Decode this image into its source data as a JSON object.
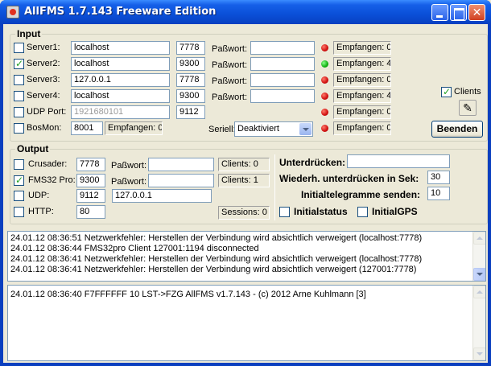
{
  "window": {
    "title": "AllFMS 1.7.143 Freeware Edition"
  },
  "input": {
    "title": "Input",
    "password_label": "Paßwort:",
    "rows": [
      {
        "label": "Server1:",
        "checked": false,
        "host": "localhost",
        "port": "7778",
        "password": "",
        "status": "red",
        "received": "Empfangen: 0"
      },
      {
        "label": "Server2:",
        "checked": true,
        "host": "localhost",
        "port": "9300",
        "password": "",
        "status": "green",
        "received": "Empfangen: 4"
      },
      {
        "label": "Server3:",
        "checked": false,
        "host": "127.0.0.1",
        "port": "7778",
        "password": "",
        "status": "red",
        "received": "Empfangen: 0"
      },
      {
        "label": "Server4:",
        "checked": false,
        "host": "localhost",
        "port": "9300",
        "password": "",
        "status": "red",
        "received": "Empfangen: 4"
      }
    ],
    "udp": {
      "label": "UDP Port:",
      "checked": false,
      "host": "1921680101",
      "port": "9112",
      "status": "red",
      "received": "Empfangen: 0"
    },
    "bosmon": {
      "label": "BosMon:",
      "checked": false,
      "port": "8001",
      "received": "Empfangen: 0"
    },
    "seriell": {
      "label": "Seriell:",
      "value": "Deaktiviert",
      "status": "red",
      "received": "Empfangen: 0"
    },
    "clients": {
      "label": "Clients",
      "checked": true,
      "icon": "monitor-icon"
    },
    "quit_button": "Beenden"
  },
  "output": {
    "title": "Output",
    "password_label": "Paßwort:",
    "crusader": {
      "label": "Crusader:",
      "checked": false,
      "port": "7778",
      "password": "",
      "status": "Clients: 0"
    },
    "fms32pro": {
      "label": "FMS32 Pro:",
      "checked": true,
      "port": "9300",
      "password": "",
      "status": "Clients: 1"
    },
    "udp": {
      "label": "UDP:",
      "checked": false,
      "port": "9112",
      "host": "127.0.0.1"
    },
    "http": {
      "label": "HTTP:",
      "checked": false,
      "port": "80",
      "status": "Sessions: 0"
    },
    "suppress_label": "Unterdrücken:",
    "suppress_value": "",
    "repeat_label": "Wiederh. unterdrücken in Sek:",
    "repeat_value": "30",
    "initial_label": "Initialtelegramme senden:",
    "initial_value": "10",
    "initialstatus": {
      "label": "Initialstatus",
      "checked": false
    },
    "initialgps": {
      "label": "InitialGPS",
      "checked": false
    }
  },
  "log": [
    "24.01.12 08:36:51 Netzwerkfehler: Herstellen der Verbindung wird absichtlich verweigert (localhost:7778)",
    "24.01.12 08:36:44 FMS32pro Client 127001:1194 disconnected",
    "24.01.12 08:36:41 Netzwerkfehler: Herstellen der Verbindung wird absichtlich verweigert (localhost:7778)",
    "24.01.12 08:36:41 Netzwerkfehler: Herstellen der Verbindung wird absichtlich verweigert (127001:7778)"
  ],
  "telegrams": [
    "24.01.12 08:36:40 F7FFFFFF 10 LST->FZG AllFMS v1.7.143 - (c) 2012 Arne Kuhlmann [3]"
  ]
}
